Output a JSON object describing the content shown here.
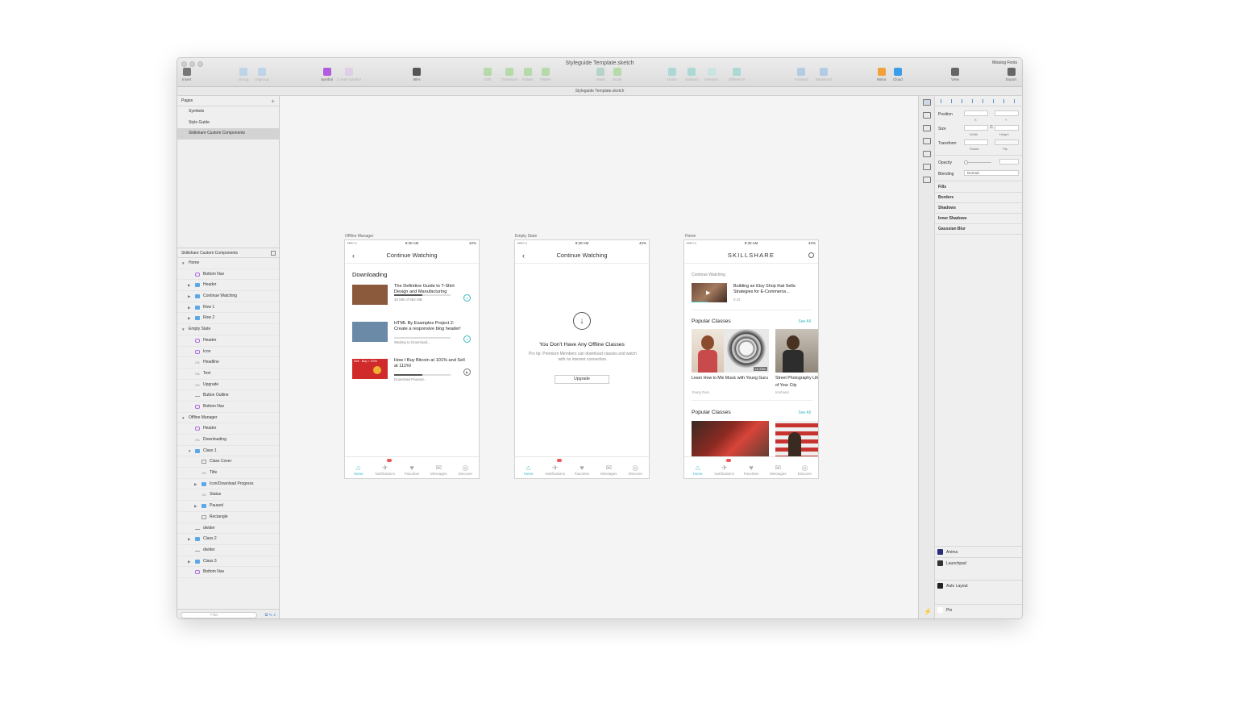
{
  "window": {
    "title": "Styleguide Template.sketch",
    "doc_tab": "Styleguide Template.sketch",
    "missing_fonts": "Missing Fonts"
  },
  "toolbar": [
    {
      "label": "Insert",
      "icon": "insert-icon",
      "dim": false,
      "color": "#777777"
    },
    {
      "label": "Group",
      "icon": "group-icon",
      "dim": true,
      "color": "#9ec7ee"
    },
    {
      "label": "Ungroup",
      "icon": "ungroup-icon",
      "dim": true,
      "color": "#9ec7ee"
    },
    {
      "label": "Symbol",
      "icon": "symbol-icon",
      "dim": false,
      "color": "#b05be0"
    },
    {
      "label": "Create Symbol",
      "icon": "create-symbol-icon",
      "dim": true,
      "color": "#dab9ef"
    },
    {
      "label": "86%",
      "icon": "zoom-icon",
      "dim": false,
      "color": "#555555"
    },
    {
      "label": "Edit",
      "icon": "edit-icon",
      "dim": true,
      "color": "#8fd27a"
    },
    {
      "label": "Transform",
      "icon": "transform-icon",
      "dim": true,
      "color": "#8fd27a"
    },
    {
      "label": "Rotate",
      "icon": "rotate-icon",
      "dim": true,
      "color": "#8fd27a"
    },
    {
      "label": "Flatten",
      "icon": "flatten-icon",
      "dim": true,
      "color": "#8fd27a"
    },
    {
      "label": "Mask",
      "icon": "mask-icon",
      "dim": true,
      "color": "#8fc7b5"
    },
    {
      "label": "Scale",
      "icon": "scale-icon",
      "dim": true,
      "color": "#8fd27a"
    },
    {
      "label": "Union",
      "icon": "union-icon",
      "dim": true,
      "color": "#7fd0c8"
    },
    {
      "label": "Subtract",
      "icon": "subtract-icon",
      "dim": true,
      "color": "#7fd0c8"
    },
    {
      "label": "Intersect",
      "icon": "intersect-icon",
      "dim": true,
      "color": "#b8e3df"
    },
    {
      "label": "Difference",
      "icon": "difference-icon",
      "dim": true,
      "color": "#7fd0c8"
    },
    {
      "label": "Forward",
      "icon": "forward-icon",
      "dim": true,
      "color": "#8ab8e8"
    },
    {
      "label": "Backward",
      "icon": "backward-icon",
      "dim": true,
      "color": "#8ab8e8"
    },
    {
      "label": "Mirror",
      "icon": "mirror-icon",
      "dim": false,
      "color": "#f0a13a"
    },
    {
      "label": "Cloud",
      "icon": "cloud-icon",
      "dim": false,
      "color": "#3a9ee8"
    },
    {
      "label": "View",
      "icon": "view-icon",
      "dim": false,
      "color": "#666666"
    },
    {
      "label": "Export",
      "icon": "export-icon",
      "dim": false,
      "color": "#666666"
    }
  ],
  "pages": {
    "header": "Pages",
    "items": [
      "Symbols",
      "Style Guide",
      "Skillshare Custom Components"
    ],
    "active_index": 2
  },
  "layers": {
    "header": "Skillshare Custom Components",
    "items": [
      {
        "label": "Home",
        "type": "group",
        "depth": 0,
        "arrow": "▼"
      },
      {
        "label": "Bottom Nav",
        "type": "symbol",
        "depth": 1
      },
      {
        "label": "Header",
        "type": "folder",
        "depth": 1,
        "arrow": "▶"
      },
      {
        "label": "Continue Watching",
        "type": "folder",
        "depth": 1,
        "arrow": "▶"
      },
      {
        "label": "Row 1",
        "type": "folder",
        "depth": 1,
        "arrow": "▶"
      },
      {
        "label": "Row 2",
        "type": "folder",
        "depth": 1,
        "arrow": "▶"
      },
      {
        "label": "Empty State",
        "type": "group",
        "depth": 0,
        "arrow": "▼"
      },
      {
        "label": "Header",
        "type": "symbol",
        "depth": 1
      },
      {
        "label": "Icon",
        "type": "symbol",
        "depth": 1
      },
      {
        "label": "Headline",
        "type": "text",
        "depth": 1
      },
      {
        "label": "Text",
        "type": "text",
        "depth": 1
      },
      {
        "label": "Upgrade",
        "type": "text",
        "depth": 1
      },
      {
        "label": "Button Outline",
        "type": "line",
        "depth": 1
      },
      {
        "label": "Bottom Nav",
        "type": "symbol",
        "depth": 1
      },
      {
        "label": "Offline Manager",
        "type": "group",
        "depth": 0,
        "arrow": "▼"
      },
      {
        "label": "Header",
        "type": "symbol",
        "depth": 1
      },
      {
        "label": "Downloading",
        "type": "text",
        "depth": 1
      },
      {
        "label": "Class 1",
        "type": "folder",
        "depth": 1,
        "arrow": "▼"
      },
      {
        "label": "Class Cover",
        "type": "rect",
        "depth": 2
      },
      {
        "label": "Title",
        "type": "text",
        "depth": 2
      },
      {
        "label": "Icon/Download Progress",
        "type": "folder",
        "depth": 2,
        "arrow": "▶"
      },
      {
        "label": "Status",
        "type": "text",
        "depth": 2
      },
      {
        "label": "Paused",
        "type": "folder",
        "depth": 2,
        "arrow": "▶"
      },
      {
        "label": "Rectangle",
        "type": "rect",
        "depth": 2
      },
      {
        "label": "divider",
        "type": "line",
        "depth": 1
      },
      {
        "label": "Class 2",
        "type": "folder",
        "depth": 1,
        "arrow": "▶"
      },
      {
        "label": "divider",
        "type": "line",
        "depth": 1
      },
      {
        "label": "Class 3",
        "type": "folder",
        "depth": 1,
        "arrow": "▶"
      },
      {
        "label": "Bottom Nav",
        "type": "symbol",
        "depth": 1
      }
    ],
    "filter_placeholder": "Filter"
  },
  "artboards": {
    "offline": {
      "label": "Offline Manager",
      "status": {
        "signal": "•••○○",
        "time": "9:30 AM",
        "battery": "42%"
      },
      "header": "Continue Watching",
      "back": "‹",
      "section": "Downloading",
      "items": [
        {
          "title": "The Definitive Guide to T-Shirt Design and Manufacturing",
          "status": "30 MB of 982 MB",
          "progress": 0.5,
          "button": "⏸",
          "button_style": "teal"
        },
        {
          "title": "HTML By Examples Project 2: Create a responsive blog header!",
          "status": "Waiting to Download...",
          "progress": 0.0,
          "button": "⏸",
          "button_style": "teal"
        },
        {
          "title": "How I Buy Bitcoin at 101% and Sell at 111%!",
          "status": "Download Paused...",
          "progress": 0.5,
          "button": "▶",
          "button_style": "gray"
        }
      ],
      "thumb_colors": [
        "#8b5a3c",
        "#6a8aa8",
        "#d12a2a"
      ],
      "thumb3_text": "Sell - Buy = 10%!"
    },
    "empty": {
      "label": "Empty State",
      "status": {
        "signal": "•••○○",
        "time": "9:30 AM",
        "battery": "42%"
      },
      "header": "Continue Watching",
      "back": "‹",
      "headline": "You Don't Have Any Offline Classes",
      "text": "Pro tip: Premium Members can download classes and watch with no internet connection.",
      "button": "Upgrade",
      "icon": "↓"
    },
    "home": {
      "label": "Home",
      "status": {
        "signal": "•••○○",
        "time": "9:30 AM",
        "battery": "42%"
      },
      "brand": "SKILLSHARE",
      "continue_label": "Continue Watching",
      "continue_title": "Building an Etsy Shop that Sells: Strategies for E-Commerce...",
      "continue_time": "0:43",
      "section1": {
        "title": "Popular Classes",
        "see_all": "See All"
      },
      "cards1": [
        {
          "title": "Learn How to Mix Music with Young Guru",
          "author": "Young Guru",
          "duration": "1h 23m"
        },
        {
          "title": "Street Photography Life of Your City",
          "author": "Ironhand",
          "duration": ""
        }
      ],
      "section2": {
        "title": "Popular Classes",
        "see_all": "See All"
      }
    },
    "tabs": [
      {
        "label": "Home",
        "icon": "⌂"
      },
      {
        "label": "Notifications",
        "icon": "✈"
      },
      {
        "label": "Favorites",
        "icon": "♥"
      },
      {
        "label": "Messages",
        "icon": "✉"
      },
      {
        "label": "Discover",
        "icon": "◎"
      }
    ]
  },
  "inspector": {
    "position": "Position",
    "x": "X",
    "y": "Y",
    "size": "Size",
    "width": "Width",
    "height": "Height",
    "transform": "Transform",
    "rotate": "Rotate",
    "flip": "Flip",
    "opacity": "Opacity",
    "blending": "Blending",
    "blending_value": "Normal",
    "sections": [
      "Fills",
      "Borders",
      "Shadows",
      "Inner Shadows",
      "Gaussian Blur"
    ],
    "plugins": [
      "Anima",
      "Launchpad",
      "Auto Layout",
      "Pin"
    ]
  },
  "colors": {
    "accent": "#3bb7c4",
    "link": "#3bb7c4"
  }
}
